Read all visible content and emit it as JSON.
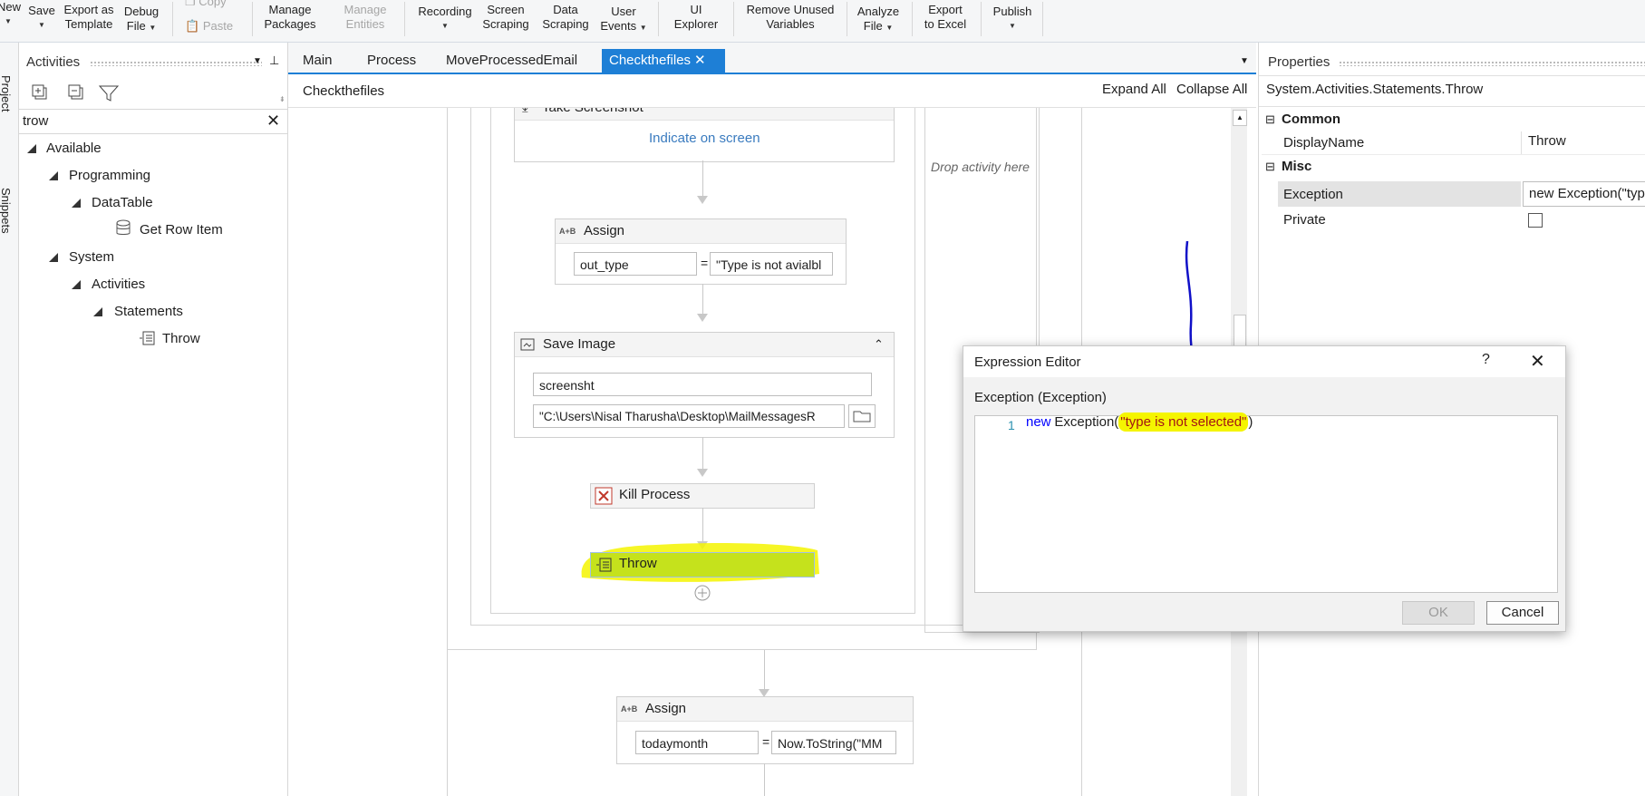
{
  "ribbon": {
    "new": "New",
    "save": "Save",
    "export_template_1": "Export as",
    "export_template_2": "Template",
    "debug_1": "Debug",
    "debug_2": "File",
    "copy": "Copy",
    "paste": "Paste",
    "manage_packages_1": "Manage",
    "manage_packages_2": "Packages",
    "manage_entities_1": "Manage",
    "manage_entities_2": "Entities",
    "recording": "Recording",
    "screen_scraping_1": "Screen",
    "screen_scraping_2": "Scraping",
    "data_scraping_1": "Data",
    "data_scraping_2": "Scraping",
    "user_events_1": "User",
    "user_events_2": "Events",
    "ui_explorer_1": "UI",
    "ui_explorer_2": "Explorer",
    "remove_unused_1": "Remove Unused",
    "remove_unused_2": "Variables",
    "analyze_1": "Analyze",
    "analyze_2": "File",
    "export_excel_1": "Export",
    "export_excel_2": "to Excel",
    "publish": "Publish"
  },
  "side_strip": {
    "project": "Project",
    "snippets": "Snippets"
  },
  "activities": {
    "title": "Activities",
    "search_value": "trow",
    "tree": {
      "available": "Available",
      "programming": "Programming",
      "datatable": "DataTable",
      "get_row_item": "Get Row Item",
      "system": "System",
      "activities": "Activities",
      "statements": "Statements",
      "throw": "Throw"
    }
  },
  "tabs": [
    "Main",
    "Process",
    "MoveProcessedEmail",
    "Checkthefiles"
  ],
  "designer": {
    "breadcrumb": "Checkthefiles",
    "expand_all": "Expand All",
    "collapse_all": "Collapse All",
    "take_screenshot": "Take Screenshot",
    "indicate_on_screen": "Indicate on screen",
    "drop_activity": "Drop activity here",
    "assign1": {
      "title": "Assign",
      "to": "out_type",
      "value": "\"Type is not avialbl"
    },
    "save_image": {
      "title": "Save Image",
      "image": "screensht",
      "path": "\"C:\\Users\\Nisal Tharusha\\Desktop\\MailMessagesR"
    },
    "kill_process": "Kill Process",
    "throw": "Throw",
    "assign2": {
      "title": "Assign",
      "to": "todaymonth",
      "value": "Now.ToString(\"MM"
    },
    "equals": "=",
    "assign_icon": "A+B"
  },
  "properties": {
    "title": "Properties",
    "type": "System.Activities.Statements.Throw",
    "common": "Common",
    "display_name_label": "DisplayName",
    "display_name_value": "Throw",
    "misc": "Misc",
    "exception_label": "Exception",
    "exception_value": "new Exception(\"type",
    "private_label": "Private"
  },
  "dialog": {
    "title": "Expression Editor",
    "help": "?",
    "subtitle": "Exception (Exception)",
    "line_number": "1",
    "code_keyword": "new",
    "code_class": "Exception(",
    "code_string": "\"type is not selected\"",
    "code_close": ")",
    "ok": "OK",
    "cancel": "Cancel"
  },
  "colors": {
    "accent": "#1e7fd6",
    "highlight": "#f5f500",
    "annotation": "#1010c8",
    "link": "#3a7bbf"
  }
}
